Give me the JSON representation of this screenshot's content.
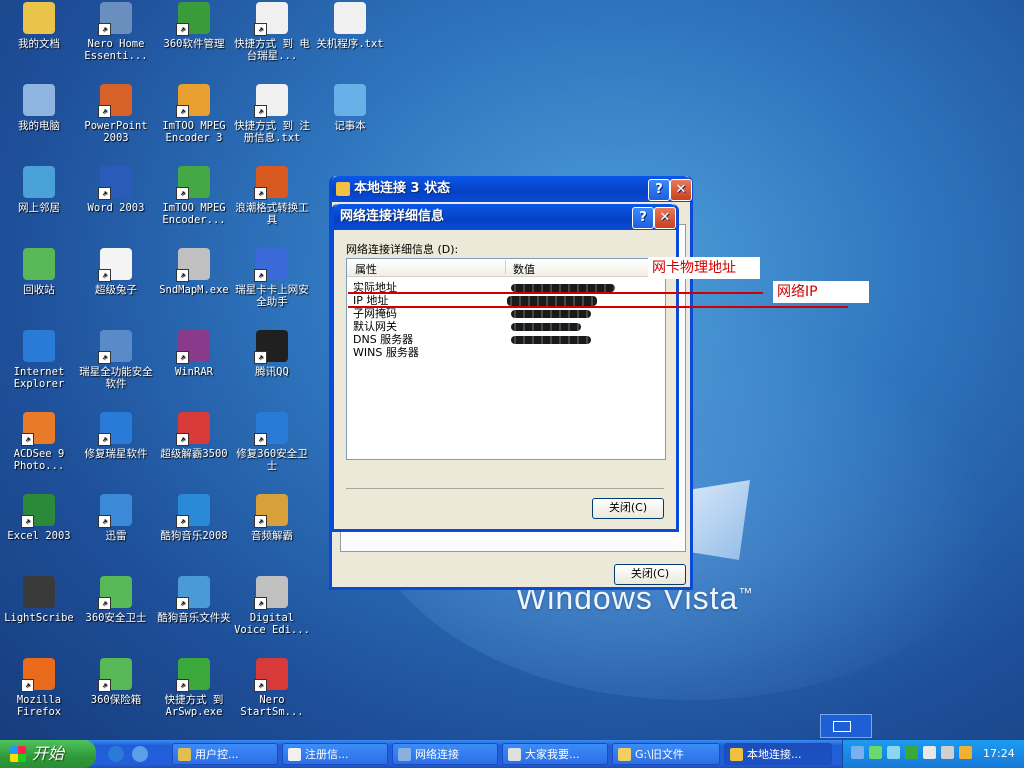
{
  "desktop_icons": [
    {
      "label": "我的文档",
      "glyph": "folder-icon",
      "color": "#e9c34a",
      "shortcut": false
    },
    {
      "label": "Nero Home Essenti...",
      "glyph": "nero-home-icon",
      "color": "#6a8fbf",
      "shortcut": true
    },
    {
      "label": "360软件管理",
      "glyph": "360-software-icon",
      "color": "#3a9b3a",
      "shortcut": true
    },
    {
      "label": "快捷方式 到 电台瑞星...",
      "glyph": "text-file-icon",
      "color": "#f0f0f0",
      "shortcut": true
    },
    {
      "label": "关机程序.txt",
      "glyph": "text-file-icon",
      "color": "#f0f0f0",
      "shortcut": false
    },
    {
      "label": "我的电脑",
      "glyph": "computer-icon",
      "color": "#8fb4e0",
      "shortcut": false
    },
    {
      "label": "PowerPoint 2003",
      "glyph": "powerpoint-icon",
      "color": "#d8612a",
      "shortcut": true
    },
    {
      "label": "ImTOO MPEG Encoder 3",
      "glyph": "imtoo-icon",
      "color": "#e8a030",
      "shortcut": true
    },
    {
      "label": "快捷方式 到 注册信息.txt",
      "glyph": "text-file-icon",
      "color": "#f0f0f0",
      "shortcut": true
    },
    {
      "label": "记事本",
      "glyph": "notepad-icon",
      "color": "#6ab0e8",
      "shortcut": false
    },
    {
      "label": "网上邻居",
      "glyph": "network-icon",
      "color": "#4aa0d8",
      "shortcut": false
    },
    {
      "label": "Word 2003",
      "glyph": "word-icon",
      "color": "#2a5bb8",
      "shortcut": true
    },
    {
      "label": "ImTOO MPEG Encoder...",
      "glyph": "imtoo-icon",
      "color": "#44a844",
      "shortcut": true
    },
    {
      "label": "浪潮格式转换工具",
      "glyph": "convert-tool-icon",
      "color": "#d85a20",
      "shortcut": true
    },
    {
      "label": "回收站",
      "glyph": "recycle-bin-icon",
      "color": "#58b858",
      "shortcut": false
    },
    {
      "label": "超级兔子",
      "glyph": "rabbit-icon",
      "color": "#f4f4f4",
      "shortcut": true
    },
    {
      "label": "SndMapM.exe",
      "glyph": "cd-icon",
      "color": "#c0c0c0",
      "shortcut": true
    },
    {
      "label": "瑞星卡卡上网安全助手",
      "glyph": "kaka-icon",
      "color": "#3a6ad8",
      "shortcut": true
    },
    {
      "label": "Internet Explorer",
      "glyph": "ie-icon",
      "color": "#2a7ad8",
      "shortcut": false
    },
    {
      "label": "瑞星全功能安全软件",
      "glyph": "rising-icon",
      "color": "#5a8ac8",
      "shortcut": true
    },
    {
      "label": "WinRAR",
      "glyph": "winrar-icon",
      "color": "#8a3a8a",
      "shortcut": true
    },
    {
      "label": "腾讯QQ",
      "glyph": "qq-icon",
      "color": "#202020",
      "shortcut": true
    },
    {
      "label": "ACDSee 9 Photo...",
      "glyph": "acdsee-icon",
      "color": "#e87a28",
      "shortcut": true
    },
    {
      "label": "修复瑞星软件",
      "glyph": "ie-repair-icon",
      "color": "#2a7ad8",
      "shortcut": true
    },
    {
      "label": "超级解霸3500",
      "glyph": "player-icon",
      "color": "#d83a3a",
      "shortcut": true
    },
    {
      "label": "修复360安全卫士",
      "glyph": "ie-repair-icon",
      "color": "#2a7ad8",
      "shortcut": true
    },
    {
      "label": "Excel 2003",
      "glyph": "excel-icon",
      "color": "#2a8a3a",
      "shortcut": true
    },
    {
      "label": "迅雷",
      "glyph": "thunder-icon",
      "color": "#3a8ad8",
      "shortcut": true
    },
    {
      "label": "酷狗音乐2008",
      "glyph": "kugou-icon",
      "color": "#2a8ad8",
      "shortcut": true
    },
    {
      "label": "音频解霸",
      "glyph": "audio-icon",
      "color": "#d8a03a",
      "shortcut": true
    },
    {
      "label": "LightScribe",
      "glyph": "lightscribe-icon",
      "color": "#3a3a3a",
      "shortcut": false
    },
    {
      "label": "360安全卫士",
      "glyph": "360-safe-icon",
      "color": "#58b858",
      "shortcut": true
    },
    {
      "label": "酷狗音乐文件夹",
      "glyph": "kugou-folder-icon",
      "color": "#4a9ad8",
      "shortcut": true
    },
    {
      "label": "Digital Voice Edi...",
      "glyph": "voice-editor-icon",
      "color": "#c0c0c0",
      "shortcut": true
    },
    {
      "label": "Mozilla Firefox",
      "glyph": "firefox-icon",
      "color": "#e86a1a",
      "shortcut": true
    },
    {
      "label": "360保险箱",
      "glyph": "360-safebox-icon",
      "color": "#58b858",
      "shortcut": true
    },
    {
      "label": "快捷方式 到 ArSwp.exe",
      "glyph": "arswp-icon",
      "color": "#3aa83a",
      "shortcut": true
    },
    {
      "label": "Nero StartSm...",
      "glyph": "nero-start-icon",
      "color": "#d83a3a",
      "shortcut": true
    }
  ],
  "wallpaper": {
    "brand": "Windows Vista",
    "tm": "™"
  },
  "back_window": {
    "title": "本地连接 3 状态",
    "close_button": "关闭(C)"
  },
  "details_dialog": {
    "title": "网络连接详细信息",
    "caption": "网络连接详细信息 (D):",
    "columns": [
      "属性",
      "数值"
    ],
    "rows": [
      "实际地址",
      "IP 地址",
      "子网掩码",
      "默认网关",
      "DNS 服务器",
      "WINS 服务器"
    ],
    "close_button": "关闭(C)"
  },
  "annotations": {
    "mac_label": "网卡物理地址",
    "ip_label": "网络IP",
    "color": "#d10000"
  },
  "taskbar": {
    "start_label": "开始",
    "tasks": [
      {
        "label": "用户控...",
        "active": false
      },
      {
        "label": "注册信...",
        "active": false
      },
      {
        "label": "网络连接",
        "active": false
      },
      {
        "label": "大家我要...",
        "active": false
      },
      {
        "label": "G:\\旧文件",
        "active": false
      },
      {
        "label": "本地连接...",
        "active": true
      }
    ],
    "clock": "17:24"
  }
}
